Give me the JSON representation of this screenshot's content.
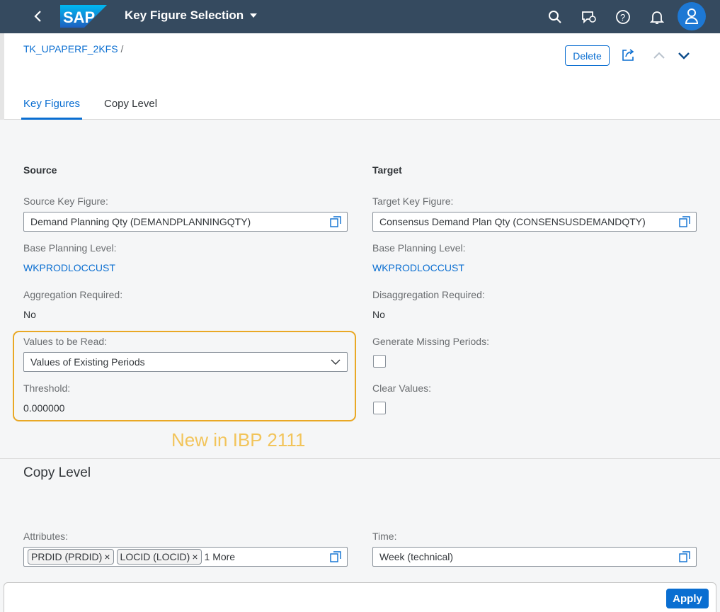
{
  "shell": {
    "logo_text": "SAP",
    "title": "Key Figure Selection",
    "brand_color": "#354a5f",
    "icons": [
      "back-icon",
      "search-icon",
      "feedback-icon",
      "help-icon",
      "notification-icon",
      "user-icon"
    ]
  },
  "header": {
    "breadcrumb_link": "TK_UPAPERF_2KFS",
    "breadcrumb_sep": "/",
    "delete_label": "Delete",
    "tabs": [
      "Key Figures",
      "Copy Level"
    ]
  },
  "source": {
    "heading": "Source",
    "key_figure_label": "Source Key Figure:",
    "key_figure_value": "Demand Planning Qty (DEMANDPLANNINGQTY)",
    "base_level_label": "Base Planning Level:",
    "base_level_value": "WKPRODLOCCUST",
    "aggregation_label": "Aggregation Required:",
    "aggregation_value": "No",
    "values_read_label": "Values to be Read:",
    "values_read_value": "Values of Existing Periods",
    "threshold_label": "Threshold:",
    "threshold_value": "0.000000"
  },
  "target": {
    "heading": "Target",
    "key_figure_label": "Target Key Figure:",
    "key_figure_value": "Consensus Demand Plan Qty (CONSENSUSDEMANDQTY)",
    "base_level_label": "Base Planning Level:",
    "base_level_value": "WKPRODLOCCUST",
    "disaggregation_label": "Disaggregation Required:",
    "disaggregation_value": "No",
    "generate_missing_label": "Generate Missing Periods:",
    "clear_values_label": "Clear Values:"
  },
  "annotation": "New in IBP 2111",
  "copy_level": {
    "title": "Copy Level",
    "attributes_label": "Attributes:",
    "tokens": [
      "PRDID (PRDID)",
      "LOCID (LOCID)"
    ],
    "more": "1 More",
    "time_label": "Time:",
    "time_value": "Week (technical)"
  },
  "footer": {
    "apply_label": "Apply"
  }
}
